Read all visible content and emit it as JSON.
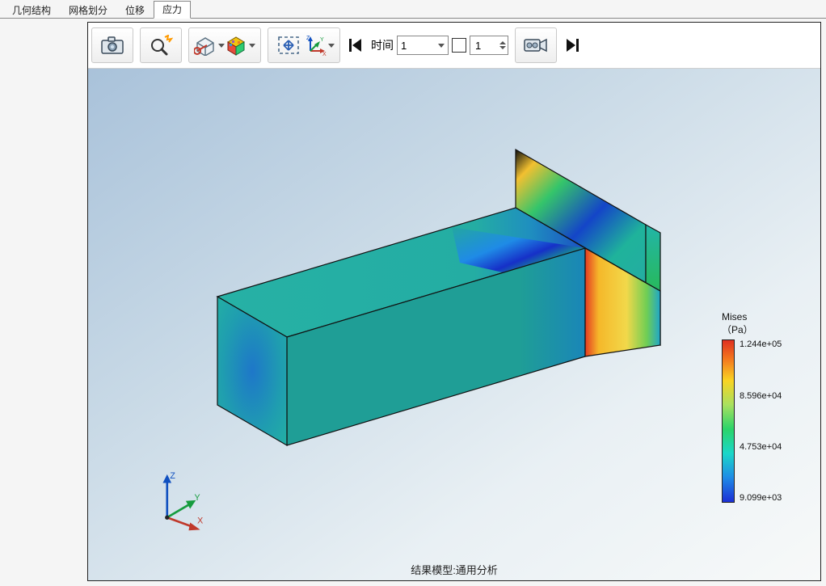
{
  "tabs": {
    "items": [
      {
        "label": "几何结构"
      },
      {
        "label": "网格划分"
      },
      {
        "label": "位移"
      },
      {
        "label": "应力"
      }
    ],
    "active_index": 3
  },
  "toolbar": {
    "icons": {
      "camera": "camera-icon",
      "zoom": "zoom-spark-icon",
      "transparency": "cube-transparency-icon",
      "colormap": "colormap-cube-icon",
      "fit": "fit-view-icon",
      "axes": "axes-triad-icon",
      "seek_left": "seek-left-icon",
      "seek_right": "seek-right-icon",
      "record": "video-camera-icon"
    },
    "time_label": "时间",
    "time_select_value": "1",
    "frame_spinner_value": "1"
  },
  "viewport": {
    "caption": "结果模型:通用分析",
    "triad_labels": {
      "x": "X",
      "y": "Y",
      "z": "Z"
    }
  },
  "legend": {
    "title_line1": "Mises",
    "title_line2": "（Pa）",
    "ticks": [
      "1.244e+05",
      "8.596e+04",
      "4.753e+04",
      "9.099e+03"
    ]
  }
}
